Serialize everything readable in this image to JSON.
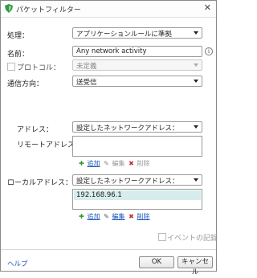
{
  "window": {
    "title": "パケットフィルター"
  },
  "fields": {
    "action": {
      "label": "処理：",
      "value": "アプリケーションルールに準拠"
    },
    "name": {
      "label": "名前：",
      "value": "Any network activity"
    },
    "protocol": {
      "label": "プロトコル：",
      "value": "未定義"
    },
    "direction": {
      "label": "通信方向：",
      "value": "送受信"
    },
    "address": {
      "label": "アドレス：",
      "value": "設定したネットワークアドレス："
    },
    "remote": {
      "label": "リモートアドレス："
    },
    "local": {
      "label": "ローカルアドレス：",
      "value": "設定したネットワークアドレス：",
      "items": [
        "192.168.96.1"
      ]
    }
  },
  "list_actions": {
    "add": "追加",
    "edit": "編集",
    "delete": "削除"
  },
  "event_log": {
    "label": "イベントの記録"
  },
  "footer": {
    "help": "ヘルプ",
    "ok": "OK",
    "cancel": "キャンセル"
  },
  "colors": {
    "link": "#1a55b6",
    "selected_row": "#d7ecec",
    "add_icon": "#2f9a2f",
    "delete_icon": "#c62b2b"
  },
  "icons": [
    "shield-app-icon",
    "close-icon",
    "info-icon",
    "add-icon",
    "edit-icon",
    "delete-icon",
    "chevron-down-icon"
  ]
}
